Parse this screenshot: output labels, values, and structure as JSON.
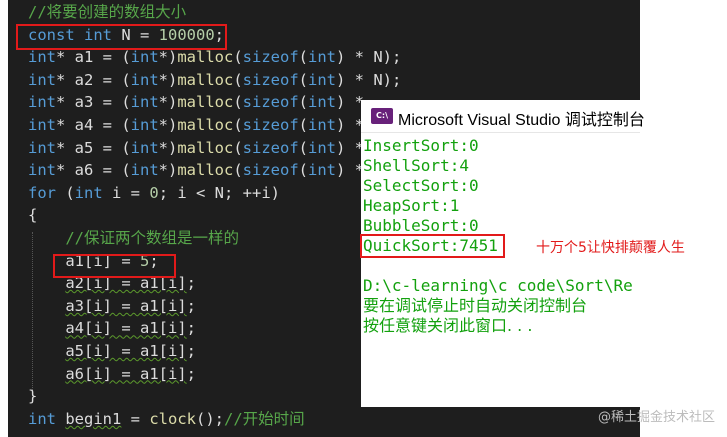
{
  "editor": {
    "lines": [
      {
        "parts": [
          {
            "t": "//将要创建的数组大小",
            "c": "cm"
          }
        ]
      },
      {
        "parts": [
          {
            "t": "const ",
            "c": "kw"
          },
          {
            "t": "int",
            "c": "kw"
          },
          {
            "t": " N = ",
            "c": ""
          },
          {
            "t": "100000",
            "c": "num"
          },
          {
            "t": ";",
            "c": ""
          }
        ]
      },
      {
        "parts": [
          {
            "t": "int",
            "c": "kw"
          },
          {
            "t": "* a1 = (",
            "c": ""
          },
          {
            "t": "int",
            "c": "kw"
          },
          {
            "t": "*)",
            "c": ""
          },
          {
            "t": "malloc",
            "c": "fn"
          },
          {
            "t": "(",
            "c": ""
          },
          {
            "t": "sizeof",
            "c": "kw"
          },
          {
            "t": "(",
            "c": ""
          },
          {
            "t": "int",
            "c": "kw"
          },
          {
            "t": ") * N);",
            "c": ""
          }
        ]
      },
      {
        "parts": [
          {
            "t": "int",
            "c": "kw"
          },
          {
            "t": "* a2 = (",
            "c": ""
          },
          {
            "t": "int",
            "c": "kw"
          },
          {
            "t": "*)",
            "c": ""
          },
          {
            "t": "malloc",
            "c": "fn"
          },
          {
            "t": "(",
            "c": ""
          },
          {
            "t": "sizeof",
            "c": "kw"
          },
          {
            "t": "(",
            "c": ""
          },
          {
            "t": "int",
            "c": "kw"
          },
          {
            "t": ") * N);",
            "c": ""
          }
        ]
      },
      {
        "parts": [
          {
            "t": "int",
            "c": "kw"
          },
          {
            "t": "* a3 = (",
            "c": ""
          },
          {
            "t": "int",
            "c": "kw"
          },
          {
            "t": "*)",
            "c": ""
          },
          {
            "t": "malloc",
            "c": "fn"
          },
          {
            "t": "(",
            "c": ""
          },
          {
            "t": "sizeof",
            "c": "kw"
          },
          {
            "t": "(",
            "c": ""
          },
          {
            "t": "int",
            "c": "kw"
          },
          {
            "t": ") *",
            "c": ""
          }
        ]
      },
      {
        "parts": [
          {
            "t": "int",
            "c": "kw"
          },
          {
            "t": "* a4 = (",
            "c": ""
          },
          {
            "t": "int",
            "c": "kw"
          },
          {
            "t": "*)",
            "c": ""
          },
          {
            "t": "malloc",
            "c": "fn"
          },
          {
            "t": "(",
            "c": ""
          },
          {
            "t": "sizeof",
            "c": "kw"
          },
          {
            "t": "(",
            "c": ""
          },
          {
            "t": "int",
            "c": "kw"
          },
          {
            "t": ") *",
            "c": ""
          }
        ]
      },
      {
        "parts": [
          {
            "t": "int",
            "c": "kw"
          },
          {
            "t": "* a5 = (",
            "c": ""
          },
          {
            "t": "int",
            "c": "kw"
          },
          {
            "t": "*)",
            "c": ""
          },
          {
            "t": "malloc",
            "c": "fn"
          },
          {
            "t": "(",
            "c": ""
          },
          {
            "t": "sizeof",
            "c": "kw"
          },
          {
            "t": "(",
            "c": ""
          },
          {
            "t": "int",
            "c": "kw"
          },
          {
            "t": ") *",
            "c": ""
          }
        ]
      },
      {
        "parts": [
          {
            "t": "int",
            "c": "kw"
          },
          {
            "t": "* a6 = (",
            "c": ""
          },
          {
            "t": "int",
            "c": "kw"
          },
          {
            "t": "*)",
            "c": ""
          },
          {
            "t": "malloc",
            "c": "fn"
          },
          {
            "t": "(",
            "c": ""
          },
          {
            "t": "sizeof",
            "c": "kw"
          },
          {
            "t": "(",
            "c": ""
          },
          {
            "t": "int",
            "c": "kw"
          },
          {
            "t": ") *",
            "c": ""
          }
        ]
      },
      {
        "parts": [
          {
            "t": "for",
            "c": "kw"
          },
          {
            "t": " (",
            "c": ""
          },
          {
            "t": "int",
            "c": "kw"
          },
          {
            "t": " i = ",
            "c": ""
          },
          {
            "t": "0",
            "c": "num"
          },
          {
            "t": "; i < N; ++i)",
            "c": ""
          }
        ]
      },
      {
        "parts": [
          {
            "t": "{",
            "c": ""
          }
        ]
      },
      {
        "parts": [
          {
            "t": "    ",
            "c": ""
          },
          {
            "t": "//保证两个数组是一样的",
            "c": "cm"
          }
        ]
      },
      {
        "parts": [
          {
            "t": "    a1[i] = ",
            "c": ""
          },
          {
            "t": "5",
            "c": "num"
          },
          {
            "t": ";",
            "c": ""
          }
        ]
      },
      {
        "parts": [
          {
            "t": "    ",
            "c": ""
          },
          {
            "t": "a2[i] = a1[i]",
            "c": "sq"
          },
          {
            "t": ";",
            "c": ""
          }
        ]
      },
      {
        "parts": [
          {
            "t": "    ",
            "c": ""
          },
          {
            "t": "a3[i] = a1[i]",
            "c": "sq"
          },
          {
            "t": ";",
            "c": ""
          }
        ]
      },
      {
        "parts": [
          {
            "t": "    ",
            "c": ""
          },
          {
            "t": "a4[i] = a1[i]",
            "c": "sq"
          },
          {
            "t": ";",
            "c": ""
          }
        ]
      },
      {
        "parts": [
          {
            "t": "    ",
            "c": ""
          },
          {
            "t": "a5[i] = a1[i]",
            "c": "sq"
          },
          {
            "t": ";",
            "c": ""
          }
        ]
      },
      {
        "parts": [
          {
            "t": "    ",
            "c": ""
          },
          {
            "t": "a6[i] = a1[i]",
            "c": "sq"
          },
          {
            "t": ";",
            "c": ""
          }
        ]
      },
      {
        "parts": [
          {
            "t": "}",
            "c": ""
          }
        ]
      },
      {
        "parts": [
          {
            "t": "int",
            "c": "kw"
          },
          {
            "t": " ",
            "c": ""
          },
          {
            "t": "begin1",
            "c": "sq"
          },
          {
            "t": " = ",
            "c": ""
          },
          {
            "t": "clock",
            "c": "fn"
          },
          {
            "t": "();",
            "c": ""
          },
          {
            "t": "//开始时间",
            "c": "cm"
          }
        ]
      }
    ]
  },
  "console": {
    "icon_label": "C:\\",
    "title": "Microsoft Visual Studio 调试控制台",
    "lines": [
      "InsertSort:0",
      "ShellSort:4",
      "SelectSort:0",
      "HeapSort:1",
      "BubbleSort:0",
      "QuickSort:7451",
      "",
      "D:\\c-learning\\c code\\Sort\\Re",
      "要在调试停止时自动关闭控制台",
      "按任意键关闭此窗口. . ."
    ]
  },
  "annotation": "十万个5让快排颠覆人生",
  "watermark": "@稀土掘金技术社区",
  "colors": {
    "editor_bg": "#1e1e1e",
    "keyword": "#569cd6",
    "comment": "#57a64a",
    "number": "#b5cea8",
    "function": "#dcdcaa",
    "console_text": "#13a10e",
    "highlight_box": "#e21a1a"
  }
}
